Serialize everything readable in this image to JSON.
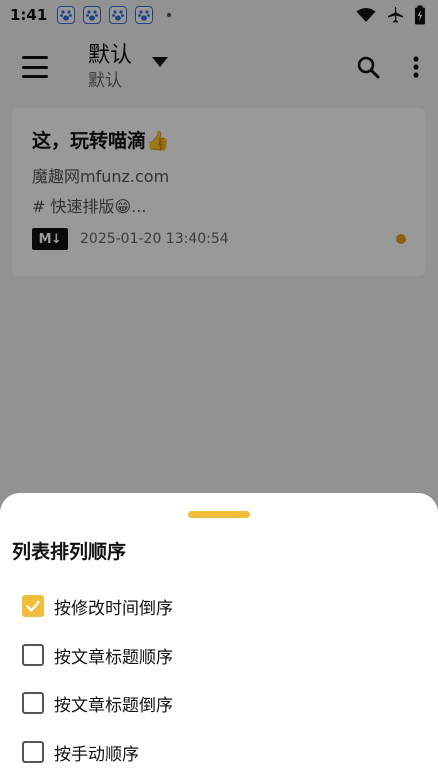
{
  "status": {
    "time": "1:41",
    "app_icons": [
      "baidu-icon",
      "baidu-icon",
      "baidu-icon",
      "baidu-icon"
    ],
    "right_icons": [
      "wifi-icon",
      "airplane-icon",
      "battery-icon"
    ]
  },
  "appbar": {
    "title": "默认",
    "subtitle": "默认"
  },
  "note": {
    "title": "这，玩转喵滴👍",
    "line1": "魔趣网mfunz.com",
    "line2": "# 快速排版😁...",
    "badge": "M↓",
    "date": "2025-01-20 13:40:54"
  },
  "sheet": {
    "title": "列表排列顺序",
    "options": [
      {
        "label": "按修改时间倒序",
        "checked": true
      },
      {
        "label": "按文章标题顺序",
        "checked": false
      },
      {
        "label": "按文章标题倒序",
        "checked": false
      },
      {
        "label": "按手动顺序",
        "checked": false
      }
    ]
  },
  "colors": {
    "accent": "#f0be3a",
    "note_dot": "#e5a21b"
  }
}
